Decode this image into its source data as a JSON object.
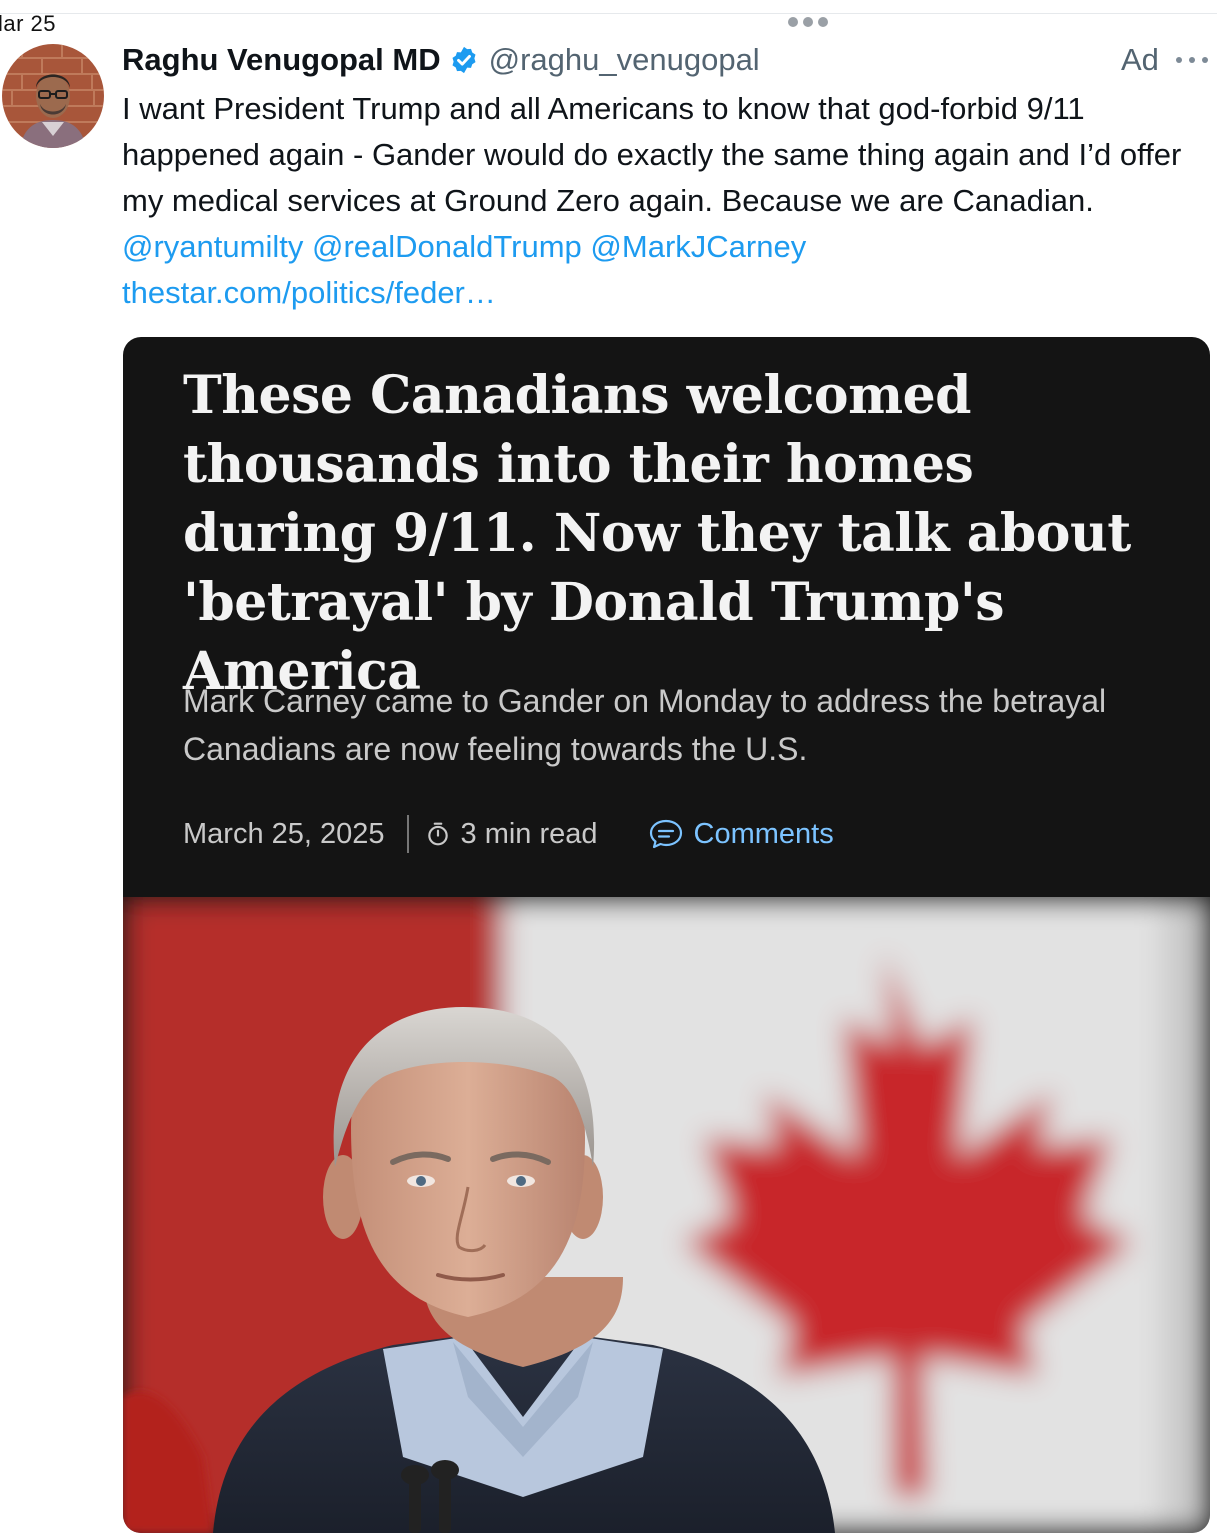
{
  "page": {
    "date_fragment": "lar 25"
  },
  "tweet": {
    "author": {
      "display_name": "Raghu Venugopal MD",
      "handle": "@raghu_venugopal",
      "verified": true
    },
    "ad_label": "Ad",
    "text": "I want President Trump and all Americans to know that god-forbid 9/11 happened again - Gander would do exactly the same thing again and I’d offer my medical services at Ground Zero again. Because we are Canadian.",
    "mentions": [
      "@ryantumilty",
      "@realDonaldTrump",
      "@MarkJCarney"
    ],
    "url": "thestar.com/politics/feder…"
  },
  "card": {
    "headline": "These Canadians welcomed thousands into their homes during 9/11. Now they talk about 'betrayal' by Donald Trump's America",
    "dek": "Mark Carney came to Gander on Monday to address the betrayal Canadians are now feeling towards the U.S.",
    "date": "March 25, 2025",
    "read_time": "3 min read",
    "comments_label": "Comments"
  },
  "colors": {
    "link": "#1d9bf0",
    "card_background": "#141414",
    "comments_accent": "#7cc3ff",
    "verified_badge": "#1d9bf0"
  },
  "icons": {
    "verified": "verified-badge-icon",
    "more": "more-dots-icon",
    "timer": "stopwatch-icon",
    "comments": "speech-bubble-icon"
  }
}
